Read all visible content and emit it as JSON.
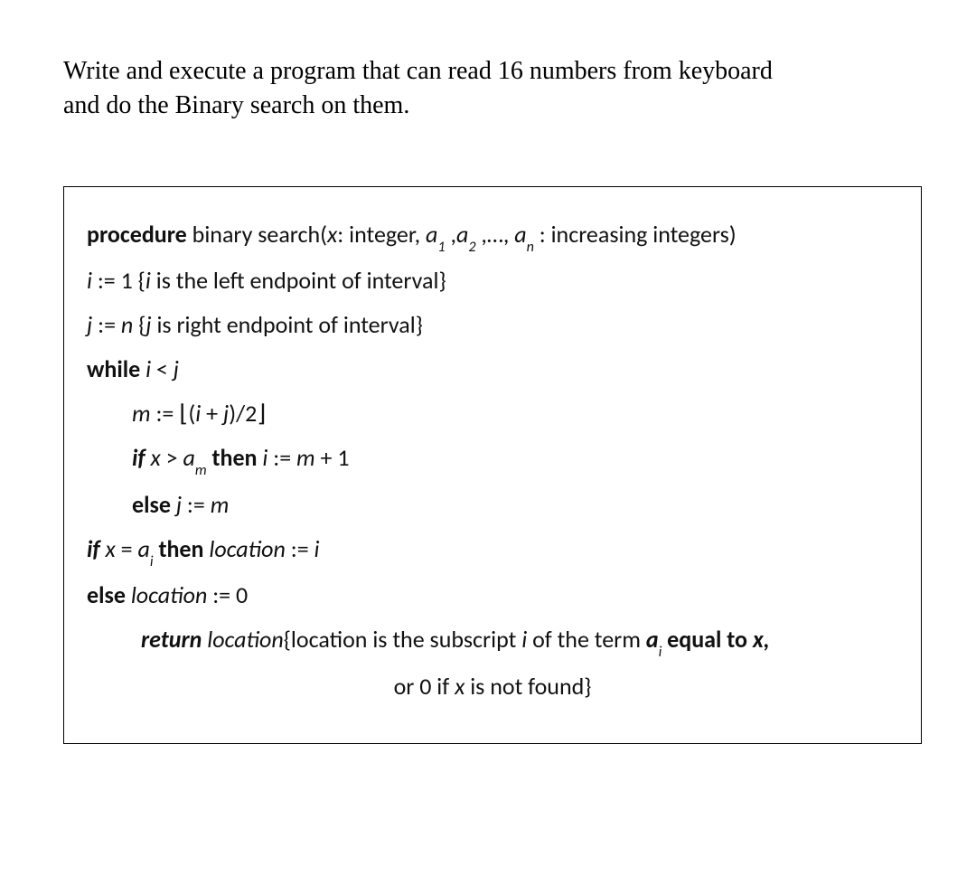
{
  "prompt": {
    "line1": "Write and execute a program that can read 16 numbers from keyboard",
    "line2": "and do the Binary search on them."
  },
  "algo": {
    "procedure_kw": "procedure",
    "procedure_name": " binary search(",
    "param_x": "x",
    "param_sep1": ": integer, ",
    "param_a": "a",
    "sub1": "1",
    "comma1": " ,",
    "sub2": "2",
    "comma2": " ,…, ",
    "subn": "n",
    "tail": " : increasing integers)",
    "line_i": "i",
    "line_i_rest": " := 1 {",
    "line_i_comment": "i",
    "line_i_end": " is the left endpoint of interval}",
    "line_j": "j",
    "line_j_rest": " := ",
    "line_j_n": "n ",
    "line_j_open": "{",
    "line_j_comment": "j",
    "line_j_end": " is right endpoint of interval}",
    "while_kw": "while",
    "while_cond_i": " i ",
    "while_lt": "< ",
    "while_cond_j": "j",
    "m_lhs": "m",
    "m_assign": " := ⌊(",
    "m_i": "i ",
    "m_plus": "+ ",
    "m_j": "j",
    "m_close": ")/2⌋",
    "if1_kw": "if",
    "if1_x": " x ",
    "if1_gt": "> ",
    "if1_a": "a",
    "if1_sub": "m",
    "then_kw": "then",
    "if1_body": " i ",
    "if1_assign": ":= ",
    "if1_m": "m ",
    "if1_plus1": "+ 1",
    "else1_kw": "else",
    "else1_j": " j ",
    "else1_assign": ":= ",
    "else1_m": "m",
    "if2_kw": "if",
    "if2_x": " x ",
    "if2_eq": "= ",
    "if2_a": "a",
    "if2_sub": "i",
    "then2_kw": "then",
    "if2_loc": " location ",
    "if2_assign": ":= ",
    "if2_i": "i",
    "else2_kw": "else",
    "else2_loc": " location ",
    "else2_assign": ":= 0",
    "return_kw": "return",
    "return_loc": " location",
    "return_open": "{location is the subscript ",
    "return_i": "i",
    "return_mid": " of the term ",
    "return_a": "a",
    "return_sub": "i",
    "return_eq": "  equal to  ",
    "return_x": "x,",
    "return_line2": "or 0 if ",
    "return_x2": "x",
    "return_end": " is not found}"
  }
}
